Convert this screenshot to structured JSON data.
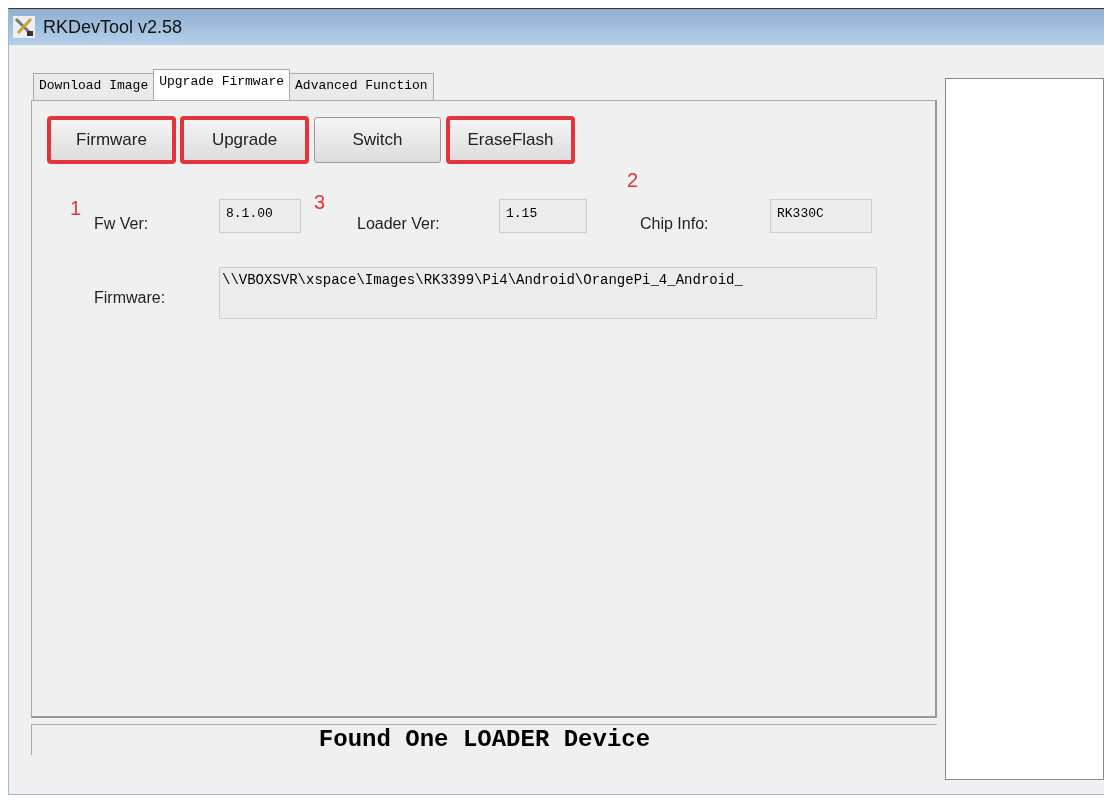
{
  "window": {
    "title": "RKDevTool v2.58"
  },
  "tabs": [
    {
      "label": "Download Image",
      "selected": false
    },
    {
      "label": "Upgrade Firmware",
      "selected": true
    },
    {
      "label": "Advanced Function",
      "selected": false
    }
  ],
  "buttons": [
    {
      "label": "Firmware",
      "highlighted": true
    },
    {
      "label": "Upgrade",
      "highlighted": true
    },
    {
      "label": "Switch",
      "highlighted": false
    },
    {
      "label": "EraseFlash",
      "highlighted": true
    }
  ],
  "annotations": [
    {
      "label": "1"
    },
    {
      "label": "3"
    },
    {
      "label": "2"
    }
  ],
  "info_fields": [
    {
      "label": "Fw Ver:",
      "value": "8.1.00"
    },
    {
      "label": "Loader Ver:",
      "value": "1.15"
    },
    {
      "label": "Chip Info:",
      "value": "RK330C"
    }
  ],
  "firmware_field": {
    "label": "Firmware:",
    "value": "\\\\VBOXSVR\\xspace\\Images\\RK3399\\Pi4\\Android\\OrangePi_4_Android_"
  },
  "status_bar": "Found One LOADER Device"
}
